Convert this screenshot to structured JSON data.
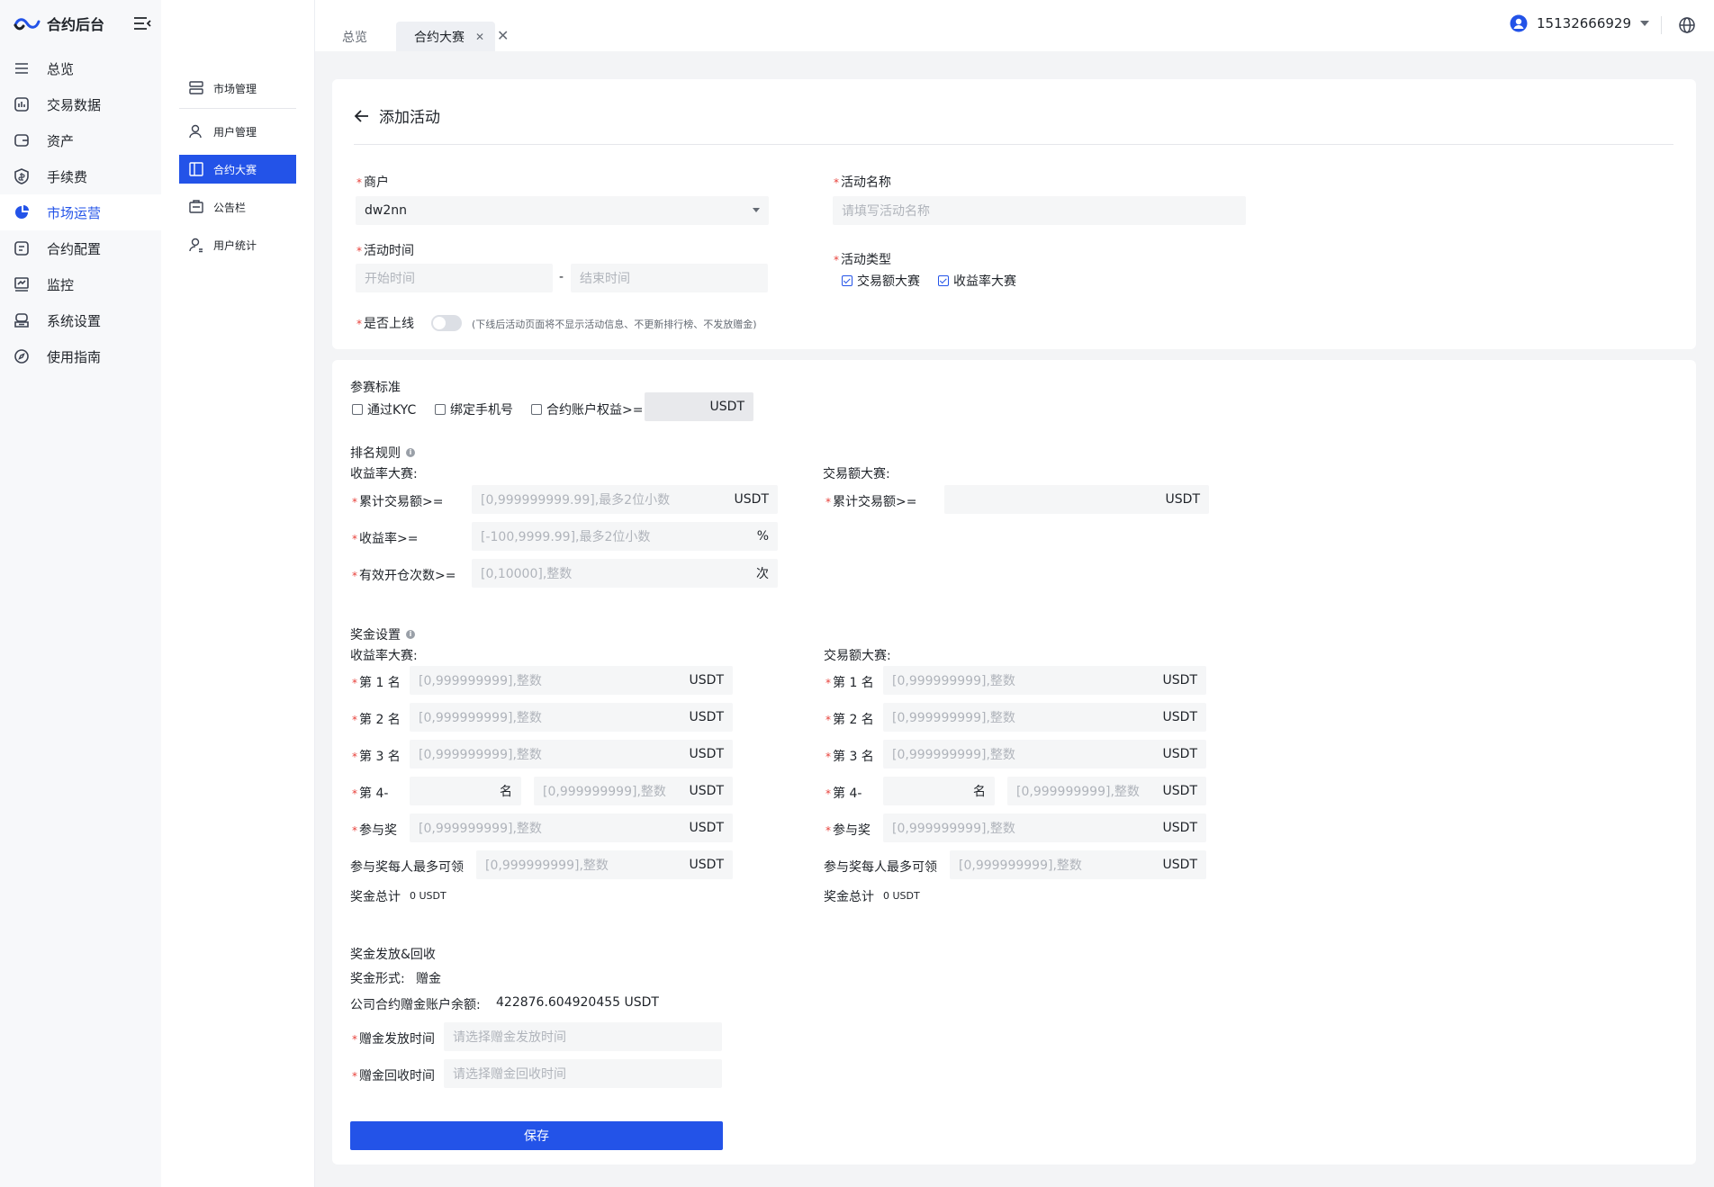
{
  "brand": {
    "name": "合约后台"
  },
  "nav": [
    {
      "label": "总览",
      "icon": "menu-icon"
    },
    {
      "label": "交易数据",
      "icon": "chart-icon"
    },
    {
      "label": "资产",
      "icon": "wallet-icon"
    },
    {
      "label": "手续费",
      "icon": "fee-shield-icon"
    },
    {
      "label": "市场运营",
      "icon": "pie-icon",
      "active": true
    },
    {
      "label": "合约配置",
      "icon": "doc-icon"
    },
    {
      "label": "监控",
      "icon": "monitor-icon"
    },
    {
      "label": "系统设置",
      "icon": "settings-icon"
    },
    {
      "label": "使用指南",
      "icon": "compass-icon"
    }
  ],
  "subnav": [
    {
      "label": "市场管理"
    },
    {
      "label": "用户管理"
    },
    {
      "label": "合约大赛",
      "active": true
    },
    {
      "label": "公告栏"
    },
    {
      "label": "用户统计"
    }
  ],
  "tabs": [
    {
      "label": "总览"
    },
    {
      "label": "合约大赛",
      "active": true
    }
  ],
  "user": {
    "phone": "15132666929"
  },
  "page": {
    "title": "添加活动"
  },
  "form": {
    "merchant_label": "商户",
    "merchant_value": "dw2nn",
    "name_label": "活动名称",
    "name_placeholder": "请填写活动名称",
    "time_label": "活动时间",
    "start_placeholder": "开始时间",
    "dash": "-",
    "end_placeholder": "结束时间",
    "type_label": "活动类型",
    "type_options": [
      "交易额大赛",
      "收益率大赛"
    ],
    "online_label": "是否上线",
    "online_hint": "(下线后活动页面将不显示活动信息、不更新排行榜、不发放赠金)"
  },
  "criteria": {
    "title": "参赛标准",
    "kyc": "通过KYC",
    "phone": "绑定手机号",
    "equity": "合约账户权益>=",
    "unit": "USDT"
  },
  "ranking": {
    "title": "排名规则",
    "yield_title": "收益率大赛:",
    "volume_title": "交易额大赛:",
    "cum_volume_label": "累计交易额>=",
    "cum_volume_placeholder": "[0,999999999.99],最多2位小数",
    "yield_rate_label": "收益率>=",
    "yield_rate_placeholder": "[-100,9999.99],最多2位小数",
    "open_count_label": "有效开仓次数>=",
    "open_count_placeholder": "[0,10000],整数",
    "unit_usdt": "USDT",
    "unit_pct": "%",
    "unit_times": "次"
  },
  "prize": {
    "title": "奖金设置",
    "yield_title": "收益率大赛:",
    "volume_title": "交易额大赛:",
    "rank1": "第 1 名",
    "rank2": "第 2 名",
    "rank3": "第 3 名",
    "rank4": "第 4-",
    "rank4_suffix": "名",
    "participate": "参与奖",
    "per_person": "参与奖每人最多可领",
    "placeholder": "[0,999999999],整数",
    "unit": "USDT",
    "total_label": "奖金总计",
    "total_value": "0 USDT"
  },
  "payout": {
    "title": "奖金发放&回收",
    "form_label": "奖金形式:",
    "form_value": "赠金",
    "balance_label": "公司合约赠金账户余额:",
    "balance_value": "422876.604920455 USDT",
    "issue_label": "赠金发放时间",
    "issue_placeholder": "请选择赠金发放时间",
    "recycle_label": "赠金回收时间",
    "recycle_placeholder": "请选择赠金回收时间"
  },
  "actions": {
    "save": "保存"
  },
  "colors": {
    "primary": "#2353e8",
    "required": "#e8403a"
  }
}
